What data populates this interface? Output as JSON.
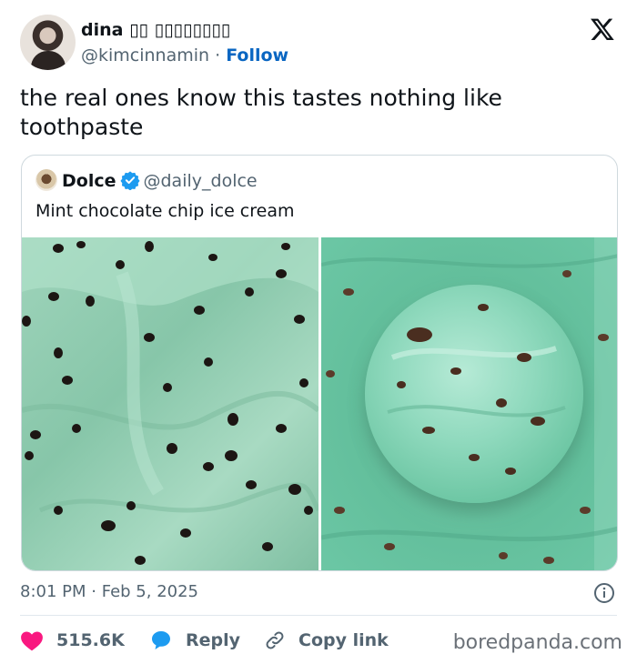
{
  "author": {
    "name": "dina",
    "name_suffix": "▯▯ ▯▯▯▯▯▯▯▯",
    "handle": "@kimcinnamin",
    "separator": " · ",
    "follow_label": "Follow",
    "avatar_icon": "user-avatar"
  },
  "brand_icon": "x-logo-icon",
  "tweet": {
    "text": "the real ones know this tastes nothing like toothpaste"
  },
  "quote": {
    "name": "Dolce",
    "handle": "@daily_dolce",
    "text": "Mint chocolate chip ice cream",
    "verified_color": "#1d9bf0"
  },
  "meta": {
    "time": "8:01 PM",
    "separator": " · ",
    "date": "Feb 5, 2025"
  },
  "actions": {
    "likes": "515.6K",
    "reply_label": "Reply",
    "copy_label": "Copy link",
    "like_color": "#f91880",
    "reply_color": "#1d9bf0"
  },
  "watermark": "boredpanda.com"
}
